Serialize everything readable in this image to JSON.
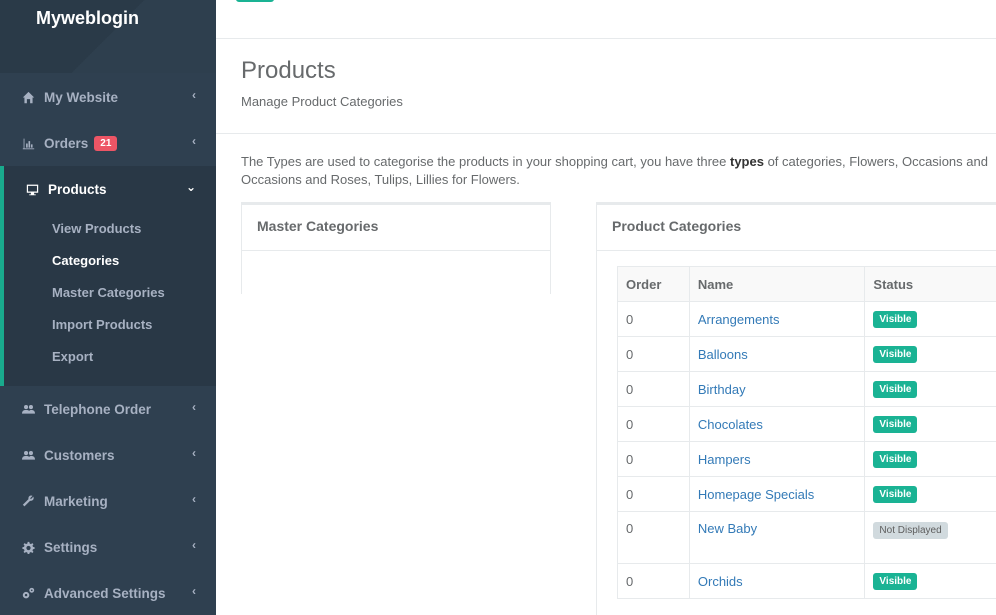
{
  "brand": "Myweblogin",
  "nav": {
    "my_website": "My Website",
    "orders": "Orders",
    "orders_badge": "21",
    "products": "Products",
    "products_sub": [
      "View Products",
      "Categories",
      "Master Categories",
      "Import Products",
      "Export"
    ],
    "telephone_order": "Telephone Order",
    "customers": "Customers",
    "marketing": "Marketing",
    "settings": "Settings",
    "advanced_settings": "Advanced Settings"
  },
  "page": {
    "title": "Products",
    "subtitle": "Manage Product Categories",
    "intro_prefix": "The Types are used to categorise the products in your shopping cart, you have three ",
    "intro_bold": "types",
    "intro_suffix": " of categories, Flowers, Occasions and",
    "intro_line2": "Occasions and Roses, Tulips, Lillies for Flowers."
  },
  "master_panel": {
    "title": "Master Categories"
  },
  "product_panel": {
    "title": "Product Categories",
    "columns": [
      "Order",
      "Name",
      "Status"
    ],
    "rows": [
      {
        "order": "0",
        "name": "Arrangements",
        "status": "Visible"
      },
      {
        "order": "0",
        "name": "Balloons",
        "status": "Visible"
      },
      {
        "order": "0",
        "name": "Birthday",
        "status": "Visible"
      },
      {
        "order": "0",
        "name": "Chocolates",
        "status": "Visible"
      },
      {
        "order": "0",
        "name": "Hampers",
        "status": "Visible"
      },
      {
        "order": "0",
        "name": "Homepage Specials",
        "status": "Visible"
      },
      {
        "order": "0",
        "name": "New Baby",
        "status": "Not Displayed"
      },
      {
        "order": "0",
        "name": "Orchids",
        "status": "Visible"
      }
    ]
  },
  "colors": {
    "sidebar": "#2f4050",
    "accent": "#1ab394",
    "badge": "#ed5565",
    "link": "#337ab7"
  }
}
